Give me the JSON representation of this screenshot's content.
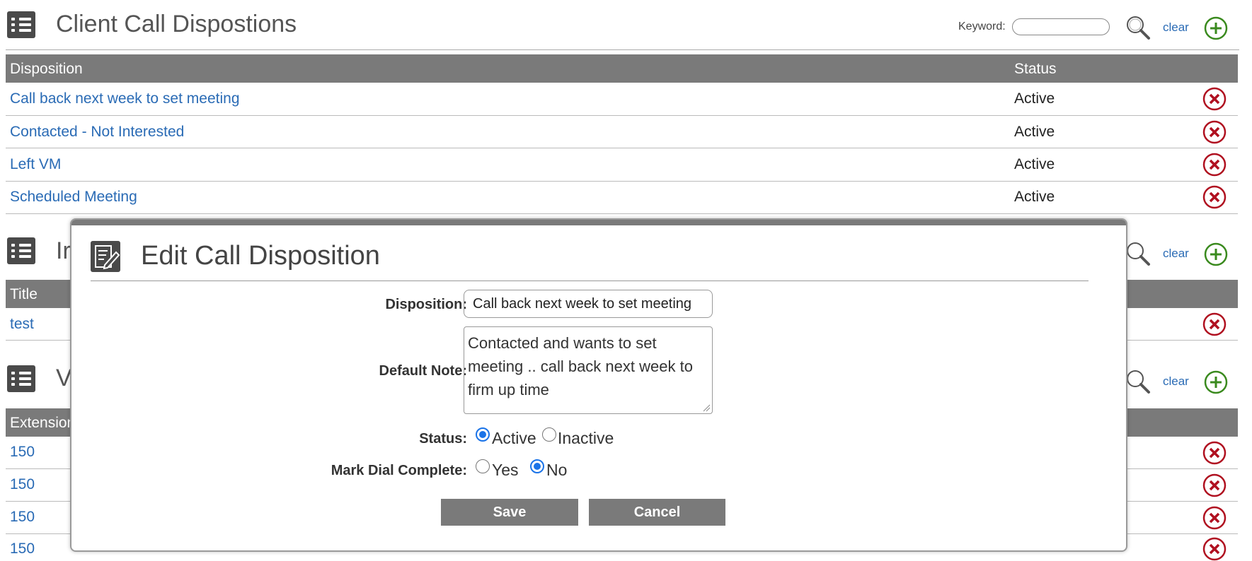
{
  "section1": {
    "title": "Client Call Dispostions",
    "keyword_label": "Keyword:",
    "keyword_value": "",
    "clear_label": "clear",
    "headers": {
      "disposition": "Disposition",
      "status": "Status"
    },
    "rows": [
      {
        "name": "Call back next week to set meeting",
        "status": "Active"
      },
      {
        "name": "Contacted - Not Interested",
        "status": "Active"
      },
      {
        "name": "Left VM",
        "status": "Active"
      },
      {
        "name": "Scheduled Meeting",
        "status": "Active"
      }
    ]
  },
  "section2": {
    "title_partial": "Ir",
    "clear_label": "clear",
    "headers": {
      "title": "Title"
    },
    "rows": [
      {
        "title": "test"
      }
    ]
  },
  "section3": {
    "title_partial": "V",
    "clear_label": "clear",
    "headers": {
      "extension": "Extension"
    },
    "rows": [
      {
        "extension": "150"
      },
      {
        "extension": "150"
      },
      {
        "extension": "150"
      },
      {
        "extension": "150"
      }
    ]
  },
  "modal": {
    "title": "Edit Call Disposition",
    "disposition_label": "Disposition:",
    "disposition_value": "Call back next week to set meeting",
    "note_label": "Default Note:",
    "note_value": "Contacted and wants to set meeting .. call back next week to firm up time",
    "status_label": "Status:",
    "status_options": [
      "Active",
      "Inactive"
    ],
    "status_selected": "Active",
    "mark_label": "Mark Dial Complete:",
    "mark_options": [
      "Yes",
      "No"
    ],
    "mark_selected": "No",
    "save_label": "Save",
    "cancel_label": "Cancel"
  },
  "colors": {
    "link": "#2a6bb5",
    "header_bar": "#7a7a7a",
    "delete_red": "#b01020",
    "add_green": "#3a8a1e",
    "radio_selected": "#1a73e8"
  },
  "icons": {
    "section": "list-icon",
    "search": "magnifier-icon",
    "add": "plus-circle-icon",
    "delete": "x-circle-icon",
    "edit": "edit-document-icon"
  }
}
